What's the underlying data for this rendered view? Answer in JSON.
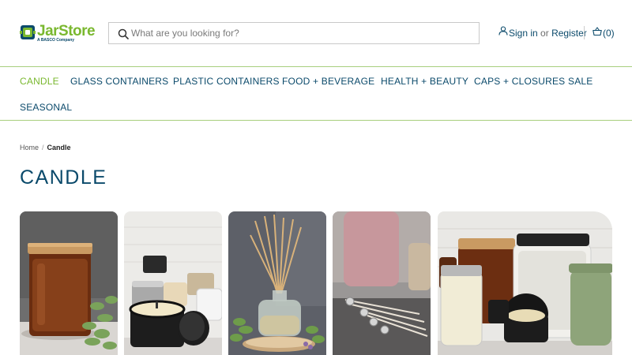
{
  "header": {
    "logo": {
      "name": "JarStore",
      "tagline": "A BASCO Company"
    },
    "search": {
      "placeholder": "What are you looking for?"
    },
    "account": {
      "sign_in": "Sign in",
      "or": "or",
      "register": "Register"
    },
    "cart": {
      "count_label": "(0)"
    }
  },
  "nav": {
    "items": [
      {
        "label": "CANDLE",
        "active": true
      },
      {
        "label": "GLASS CONTAINERS"
      },
      {
        "label": "PLASTIC CONTAINERS"
      },
      {
        "label": "FOOD + BEVERAGE"
      },
      {
        "label": "HEALTH + BEAUTY"
      },
      {
        "label": "CAPS + CLOSURES"
      },
      {
        "label": "SALE"
      },
      {
        "label": "SEASONAL"
      }
    ]
  },
  "breadcrumb": {
    "home": "Home",
    "separator": "/",
    "current": "Candle"
  },
  "page": {
    "title": "CANDLE"
  },
  "colors": {
    "brand_green": "#7ab82f",
    "brand_navy": "#0b4a6b",
    "rule_green": "#a8cf7e"
  },
  "icons": [
    "jarstore-logo-icon",
    "search-icon",
    "user-icon",
    "basket-icon"
  ],
  "category_tiles": [
    {
      "subject": "amber glass candle jar with wood lid"
    },
    {
      "subject": "black and silver candle tins"
    },
    {
      "subject": "reed diffuser glass bottle"
    },
    {
      "subject": "candle wicks"
    },
    {
      "subject": "assorted candle jars and tins"
    }
  ]
}
